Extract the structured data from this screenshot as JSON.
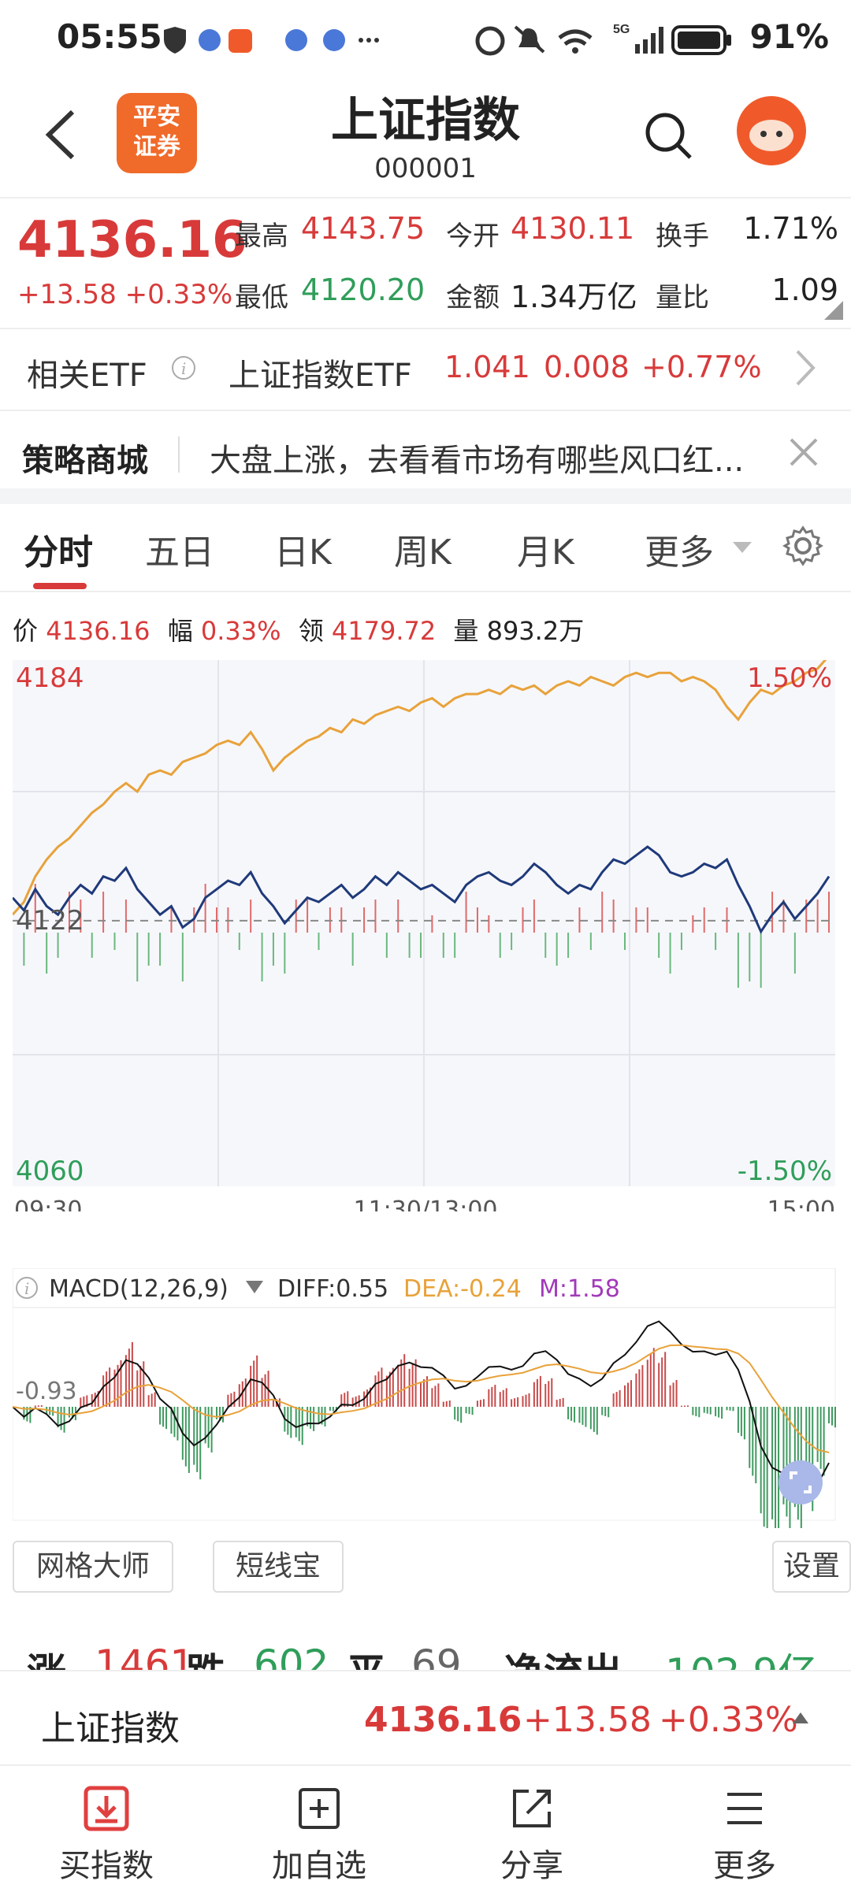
{
  "status_bar": {
    "time": "05:55",
    "signal": "5G",
    "battery": "91%"
  },
  "header": {
    "back_icon": "chevron-left-icon",
    "logo_text_line1": "平安",
    "logo_text_line2": "证券",
    "title": "上证指数",
    "code": "000001",
    "search_icon": "search-icon"
  },
  "quote": {
    "price": "4136.16",
    "change": "+13.58",
    "change_pct": "+0.33%",
    "high_label": "最高",
    "high": "4143.75",
    "open_label": "今开",
    "open": "4130.11",
    "turnover_label": "换手",
    "turnover": "1.71%",
    "low_label": "最低",
    "low": "4120.20",
    "amount_label": "金额",
    "amount": "1.34万亿",
    "vol_ratio_label": "量比",
    "vol_ratio": "1.09"
  },
  "etf": {
    "label": "相关ETF",
    "name": "上证指数ETF",
    "price": "1.041",
    "change": "0.008",
    "change_pct": "+0.77%"
  },
  "strategy": {
    "label": "策略商城",
    "text": "大盘上涨，去看看市场有哪些风口红..."
  },
  "tabs": [
    "分时",
    "五日",
    "日K",
    "周K",
    "月K",
    "更多"
  ],
  "chart_info": {
    "price_label": "价",
    "price": "4136.16",
    "amp_label": "幅",
    "amp": "0.33%",
    "lead_label": "领",
    "lead": "4179.72",
    "vol_label": "量",
    "vol": "893.2万"
  },
  "chart_data": {
    "type": "line",
    "y_ticks": {
      "top": "4184",
      "mid": "4122",
      "bottom": "4060"
    },
    "pct_ticks": {
      "top": "1.50%",
      "bottom": "-1.50%"
    },
    "x_labels": [
      "09:30",
      "11:30/13:00",
      "15:00"
    ],
    "ylim": [
      4060,
      4184
    ],
    "prev_close": 4122.58,
    "series": [
      {
        "name": "上证指数",
        "color": "#1f3a7a",
        "values": [
          4128,
          4125,
          4130,
          4126,
          4124,
          4128,
          4131,
          4129,
          4133,
          4132,
          4135,
          4130,
          4127,
          4124,
          4126,
          4121,
          4123,
          4128,
          4130,
          4132,
          4131,
          4134,
          4129,
          4126,
          4122,
          4125,
          4128,
          4127,
          4129,
          4131,
          4128,
          4130,
          4133,
          4131,
          4134,
          4132,
          4130,
          4131,
          4129,
          4127,
          4131,
          4133,
          4134,
          4132,
          4131,
          4133,
          4136,
          4134,
          4131,
          4129,
          4131,
          4130,
          4134,
          4137,
          4136,
          4138,
          4140,
          4138,
          4134,
          4133,
          4134,
          4136,
          4135,
          4137,
          4131,
          4126,
          4120,
          4124,
          4127,
          4123,
          4126,
          4129,
          4133
        ]
      },
      {
        "name": "领先指标",
        "color": "#e8a23a",
        "values": [
          4124,
          4127,
          4133,
          4137,
          4140,
          4142,
          4145,
          4148,
          4150,
          4153,
          4155,
          4153,
          4157,
          4158,
          4157,
          4160,
          4161,
          4162,
          4164,
          4165,
          4164,
          4167,
          4163,
          4158,
          4161,
          4163,
          4165,
          4166,
          4168,
          4167,
          4170,
          4169,
          4171,
          4172,
          4173,
          4172,
          4174,
          4175,
          4173,
          4175,
          4176,
          4176,
          4177,
          4176,
          4178,
          4177,
          4178,
          4176,
          4178,
          4179,
          4178,
          4180,
          4179,
          4178,
          4180,
          4181,
          4180,
          4181,
          4181,
          4179,
          4180,
          4179,
          4177,
          4173,
          4170,
          4174,
          4177,
          4176,
          4178,
          4179,
          4181,
          4182,
          4185
        ]
      }
    ],
    "macd": {
      "label": "MACD(12,26,9)",
      "diff_label": "DIFF:0.55",
      "dea_label": "DEA:-0.24",
      "m_label": "M:1.58",
      "axis_label": "-0.93"
    }
  },
  "tools": {
    "grid_master": "网格大师",
    "short_line": "短线宝",
    "settings": "设置"
  },
  "breadth": {
    "up_label": "涨",
    "up": "1461",
    "down_label": "跌",
    "down": "602",
    "flat_label": "平",
    "flat": "69",
    "flow_label": "净流出",
    "flow": "-102.9亿"
  },
  "sticky": {
    "name": "上证指数",
    "price": "4136.16",
    "change": "+13.58",
    "change_pct": "+0.33%"
  },
  "nav": [
    {
      "label": "买指数",
      "icon": "download-icon"
    },
    {
      "label": "加自选",
      "icon": "add-square-icon"
    },
    {
      "label": "分享",
      "icon": "share-icon"
    },
    {
      "label": "更多",
      "icon": "menu-icon"
    }
  ],
  "colors": {
    "up": "#d83a3a",
    "down": "#2f9e5a",
    "accent": "#f06a2a"
  }
}
